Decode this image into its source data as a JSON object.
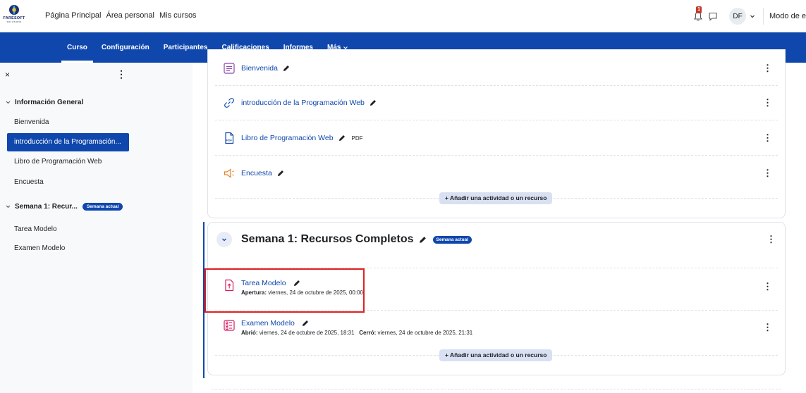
{
  "brand": {
    "logo_text": "FARESOFT",
    "logo_sub": "SOLUTIONS"
  },
  "topnav": [
    "Página Principal",
    "Área personal",
    "Mis cursos"
  ],
  "user": {
    "initials": "DF",
    "notifications": "1",
    "edit_mode_label": "Modo de e"
  },
  "secnav": {
    "items": [
      "Curso",
      "Configuración",
      "Participantes",
      "Calificaciones",
      "Informes",
      "Más"
    ],
    "active": "Curso"
  },
  "drawer": {
    "close": "×",
    "sections": [
      {
        "title": "Información General",
        "items": [
          "Bienvenida",
          "introducción de la Programación...",
          "Libro de Programación Web",
          "Encuesta"
        ]
      },
      {
        "title": "Semana 1: Recur...",
        "badge": "Semana actual",
        "items": [
          "Tarea Modelo",
          "Examen Modelo"
        ]
      }
    ],
    "active_item": "introducción de la Programación..."
  },
  "general": {
    "activities": [
      {
        "title": "Bienvenida",
        "icon": "page-icon"
      },
      {
        "title": "introducción de la Programación Web",
        "icon": "url-icon"
      },
      {
        "title": "Libro de Programación Web",
        "icon": "pdf-icon",
        "tag": "PDF"
      },
      {
        "title": "Encuesta",
        "icon": "feedback-icon"
      }
    ],
    "add_label": "+ Añadir una actividad o un recurso"
  },
  "week1": {
    "title": "Semana 1: Recursos Completos",
    "badge": "Semana actual",
    "activities": [
      {
        "title": "Tarea Modelo",
        "icon": "assignment-icon",
        "line1_label": "Apertura:",
        "line1_value": " viernes, 24 de octubre de 2025, 00:00"
      },
      {
        "title": "Examen Modelo",
        "icon": "quiz-icon",
        "line1_label": "Abrió:",
        "line1_value": " viernes, 24 de octubre de 2025, 18:31",
        "line2_label": "Cerró:",
        "line2_value": " viernes, 24 de octubre de 2025, 21:31"
      }
    ],
    "add_label": "+ Añadir una actividad o un recurso"
  },
  "colors": {
    "primary": "#0f47ad",
    "highlight": "#e02020"
  }
}
